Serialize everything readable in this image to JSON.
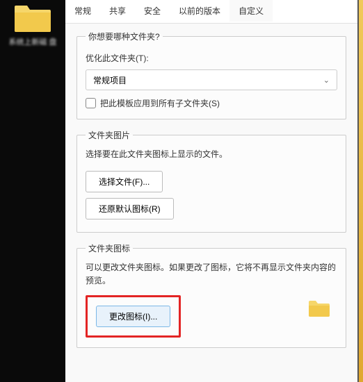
{
  "desktop": {
    "icon_label": "系统上新磁\n盘"
  },
  "tabs": {
    "general": "常规",
    "sharing": "共享",
    "security": "安全",
    "previous": "以前的版本",
    "customize": "自定义"
  },
  "section1": {
    "legend": "你想要哪种文件夹?",
    "optimize_label": "优化此文件夹(T):",
    "dropdown_value": "常规项目",
    "checkbox_label": "把此模板应用到所有子文件夹(S)"
  },
  "section2": {
    "legend": "文件夹图片",
    "desc": "选择要在此文件夹图标上显示的文件。",
    "choose_btn": "选择文件(F)...",
    "restore_btn": "还原默认图标(R)"
  },
  "section3": {
    "legend": "文件夹图标",
    "desc": "可以更改文件夹图标。如果更改了图标，它将不再显示文件夹内容的预览。",
    "change_btn": "更改图标(I)..."
  }
}
